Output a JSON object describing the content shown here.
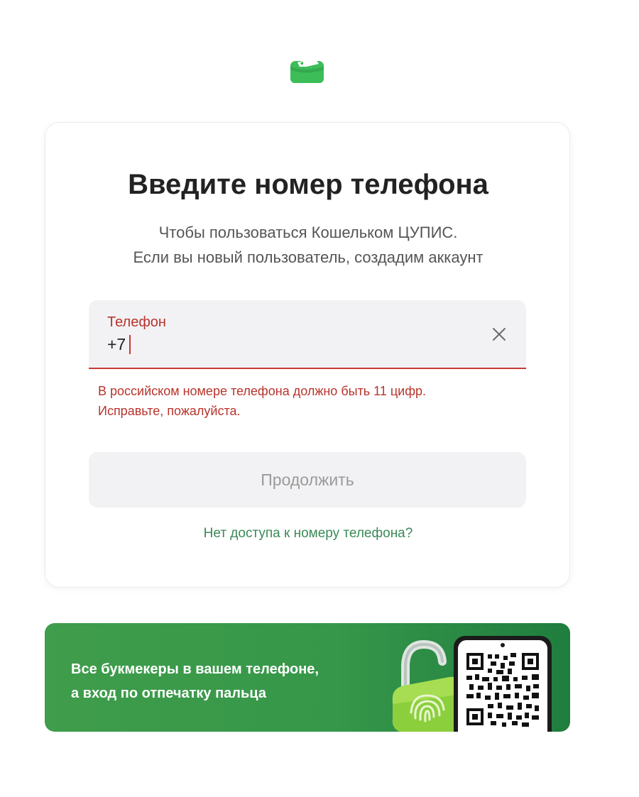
{
  "logo": {
    "name": "wallet-logo",
    "color": "#3cbd58"
  },
  "card": {
    "title": "Введите номер телефона",
    "subtitle_line1": "Чтобы пользоваться Кошельком ЦУПИС.",
    "subtitle_line2": "Если вы новый пользователь, создадим аккаунт"
  },
  "phone_field": {
    "label": "Телефон",
    "value": "+7",
    "clear_icon": "close-icon",
    "state": "error"
  },
  "error": {
    "line1": "В российском номере телефона должно быть 11 цифр.",
    "line2": "Исправьте, пожалуйста."
  },
  "actions": {
    "continue_label": "Продолжить",
    "continue_disabled": true,
    "no_access_link": "Нет доступа к номеру телефона?"
  },
  "banner": {
    "line1": "Все букмекеры в вашем телефоне,",
    "line2": "а вход по отпечатку пальца",
    "lock_icon": "fingerprint-lock-icon",
    "qr_icon": "qr-code-icon"
  },
  "colors": {
    "accent_green": "#3cbd58",
    "error_red": "#c83a34",
    "link_green": "#3a8a58",
    "banner_green": "#36974a"
  }
}
